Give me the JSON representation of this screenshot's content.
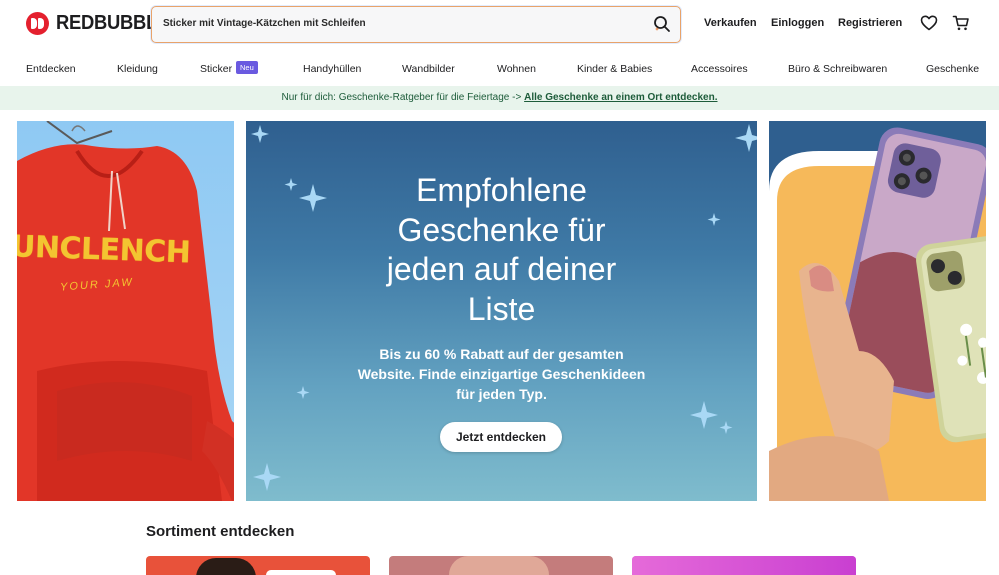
{
  "header": {
    "brand": "REDBUBBLE",
    "search_query": "Sticker mit Vintage-Kätzchen mit Schleifen",
    "links": {
      "sell": "Verkaufen",
      "login": "Einloggen",
      "register": "Registrieren"
    },
    "icons": [
      "search-icon",
      "heart-icon",
      "cart-icon"
    ]
  },
  "categories": [
    {
      "label": "Entdecken"
    },
    {
      "label": "Kleidung"
    },
    {
      "label": "Sticker",
      "badge": "Neu"
    },
    {
      "label": "Handyhüllen"
    },
    {
      "label": "Wandbilder"
    },
    {
      "label": "Wohnen"
    },
    {
      "label": "Kinder & Babies"
    },
    {
      "label": "Accessoires"
    },
    {
      "label": "Büro & Schreibwaren"
    },
    {
      "label": "Geschenke"
    }
  ],
  "promo": {
    "text": "Nur für dich: Geschenke-Ratgeber für die Feiertage ->",
    "link": "Alle Geschenke an einem Ort entdecken."
  },
  "hero": {
    "title_lines": [
      "Empfohlene",
      "Geschenke für",
      "jeden auf deiner",
      "Liste"
    ],
    "subtitle_lines": [
      "Bis zu 60 % Rabatt auf der gesamten",
      "Website. Finde einzigartige Geschenkideen",
      "für jeden Typ."
    ],
    "cta": "Jetzt entdecken",
    "hoodie_print": {
      "line1": "UNCLENCH",
      "line2": "YOUR JAW"
    }
  },
  "section": {
    "title": "Sortiment entdecken"
  },
  "colors": {
    "brand_red": "#e4202e",
    "badge_purple": "#6a5ae0",
    "promo_bg": "#e8f4ec",
    "promo_text": "#1d5c3a",
    "hero_top": "#2f5f8f",
    "hero_bottom": "#7fbccd"
  }
}
